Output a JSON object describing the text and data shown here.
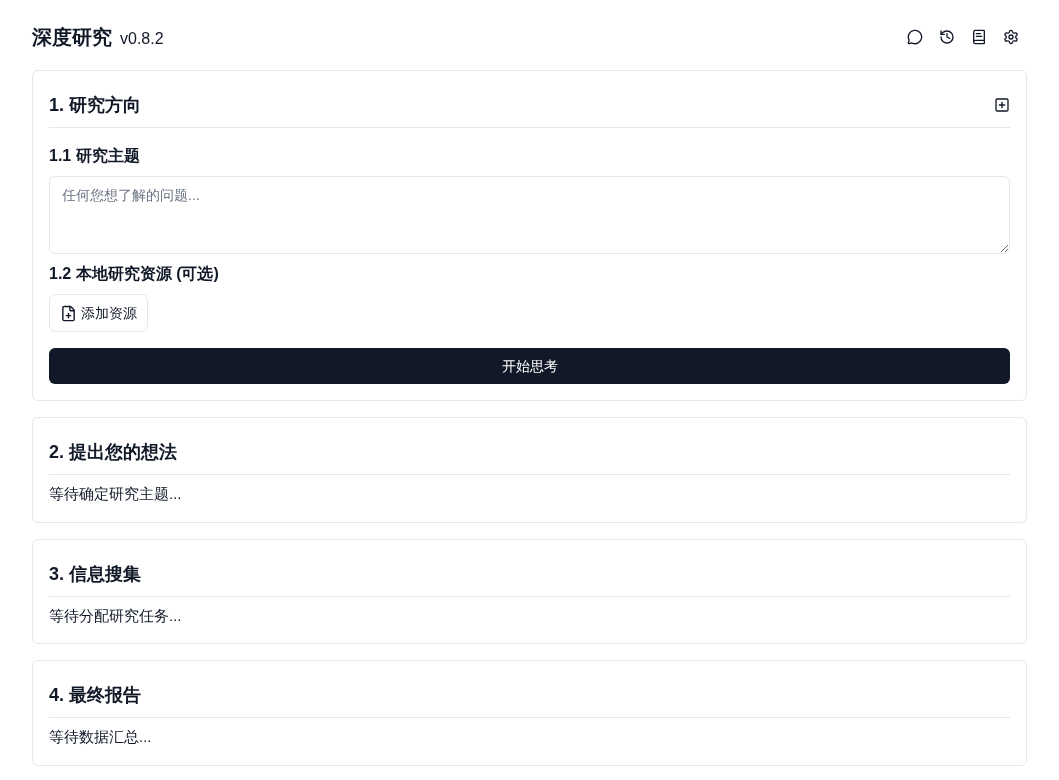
{
  "header": {
    "title": "深度研究",
    "version": "v0.8.2"
  },
  "sections": [
    {
      "kind": "form",
      "title": "1. 研究方向",
      "topic_label": "1.1 研究主题",
      "topic_placeholder": "任何您想了解的问题...",
      "resources_label": "1.2 本地研究资源 (可选)",
      "add_resource_button": "添加资源",
      "start_button": "开始思考"
    },
    {
      "kind": "waiting",
      "title": "2. 提出您的想法",
      "status": "等待确定研究主题..."
    },
    {
      "kind": "waiting",
      "title": "3. 信息搜集",
      "status": "等待分配研究任务..."
    },
    {
      "kind": "waiting",
      "title": "4. 最终报告",
      "status": "等待数据汇总..."
    }
  ]
}
